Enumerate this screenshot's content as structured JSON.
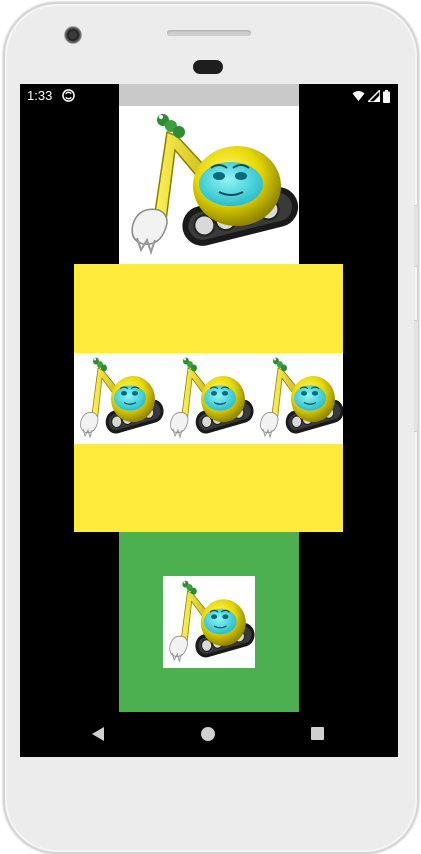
{
  "status_bar": {
    "time": "1:33",
    "icons": [
      "sync-icon",
      "wifi-icon",
      "cell-signal-icon",
      "battery-icon"
    ]
  },
  "content": {
    "top_image": {
      "icon": "excavator-image"
    },
    "yellow_panel": {
      "color": "#ffeb3b",
      "tiles": [
        "excavator-image",
        "excavator-image",
        "excavator-image"
      ]
    },
    "green_panel": {
      "color": "#4caf50",
      "image": "excavator-image"
    }
  },
  "nav_bar": {
    "buttons": [
      "back-icon",
      "home-icon",
      "recents-icon"
    ]
  },
  "colors": {
    "screen_background": "#000000",
    "status_strip": "#c9c9c9"
  }
}
